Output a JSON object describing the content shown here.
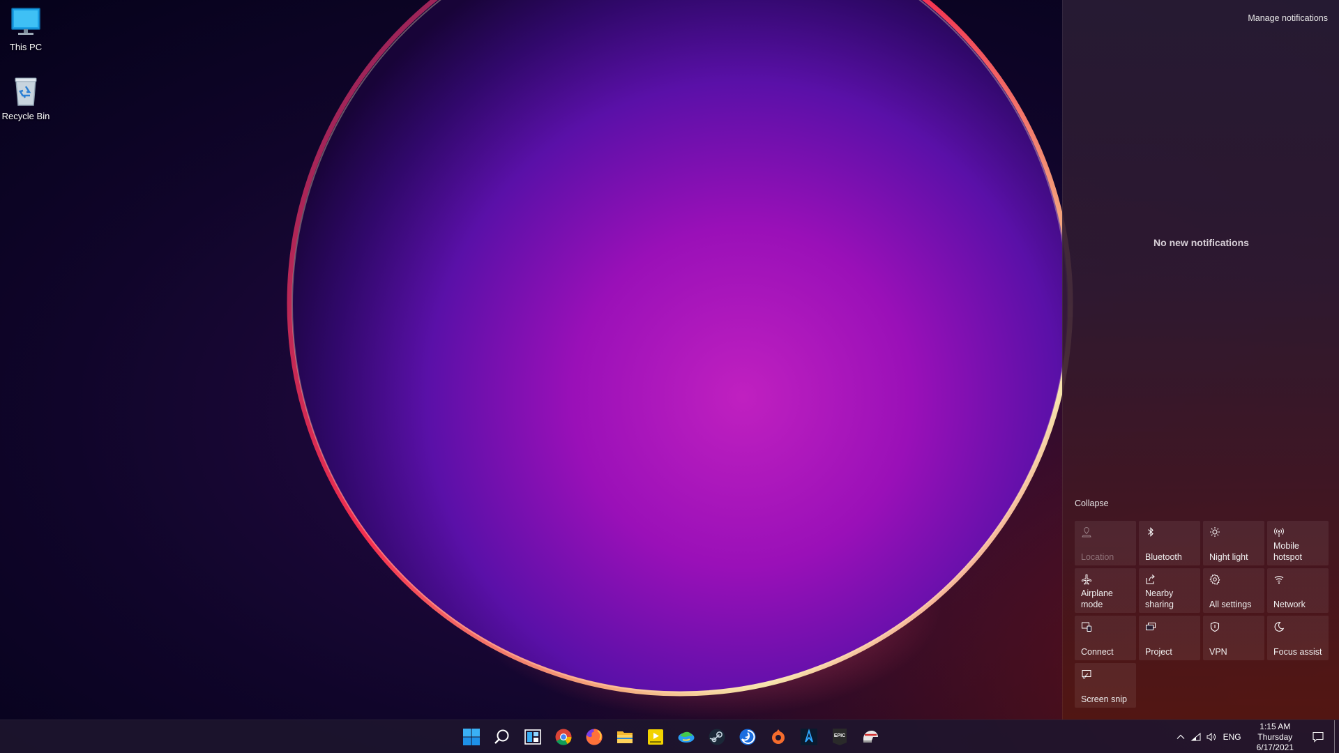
{
  "desktop": {
    "icons": [
      {
        "label": "This PC",
        "icon": "monitor-icon"
      },
      {
        "label": "Recycle Bin",
        "icon": "recycle-bin-icon"
      }
    ]
  },
  "action_center": {
    "manage_label": "Manage notifications",
    "empty_label": "No new notifications",
    "collapse_label": "Collapse",
    "tiles": [
      {
        "label": "Location",
        "icon": "location-icon",
        "enabled": false
      },
      {
        "label": "Bluetooth",
        "icon": "bluetooth-icon",
        "enabled": true
      },
      {
        "label": "Night light",
        "icon": "brightness-icon",
        "enabled": true
      },
      {
        "label": "Mobile hotspot",
        "icon": "hotspot-icon",
        "enabled": true
      },
      {
        "label": "Airplane mode",
        "icon": "airplane-icon",
        "enabled": true
      },
      {
        "label": "Nearby sharing",
        "icon": "share-icon",
        "enabled": true
      },
      {
        "label": "All settings",
        "icon": "gear-icon",
        "enabled": true
      },
      {
        "label": "Network",
        "icon": "network-icon",
        "enabled": true
      },
      {
        "label": "Connect",
        "icon": "connect-icon",
        "enabled": true
      },
      {
        "label": "Project",
        "icon": "project-icon",
        "enabled": true
      },
      {
        "label": "VPN",
        "icon": "shield-icon",
        "enabled": true
      },
      {
        "label": "Focus assist",
        "icon": "moon-icon",
        "enabled": true
      },
      {
        "label": "Screen snip",
        "icon": "screen-snip-icon",
        "enabled": true
      }
    ]
  },
  "taskbar": {
    "apps": [
      {
        "icon": "windows-start-icon"
      },
      {
        "icon": "search-icon"
      },
      {
        "icon": "widgets-icon"
      },
      {
        "icon": "chrome-icon"
      },
      {
        "icon": "firefox-icon"
      },
      {
        "icon": "file-explorer-icon"
      },
      {
        "icon": "player-icon"
      },
      {
        "icon": "earth-icon"
      },
      {
        "icon": "steam-icon"
      },
      {
        "icon": "uplay-icon"
      },
      {
        "icon": "origin-icon"
      },
      {
        "icon": "game-launcher-icon"
      },
      {
        "icon": "epic-games-icon"
      },
      {
        "icon": "helmet-app-icon"
      }
    ],
    "epic_text": "EPIC",
    "tray": {
      "language": "ENG",
      "time": "1:15 AM",
      "day": "Thursday",
      "date": "6/17/2021"
    }
  },
  "colors": {
    "accent": "#0078d4",
    "panel_text": "#f0f0f0"
  }
}
